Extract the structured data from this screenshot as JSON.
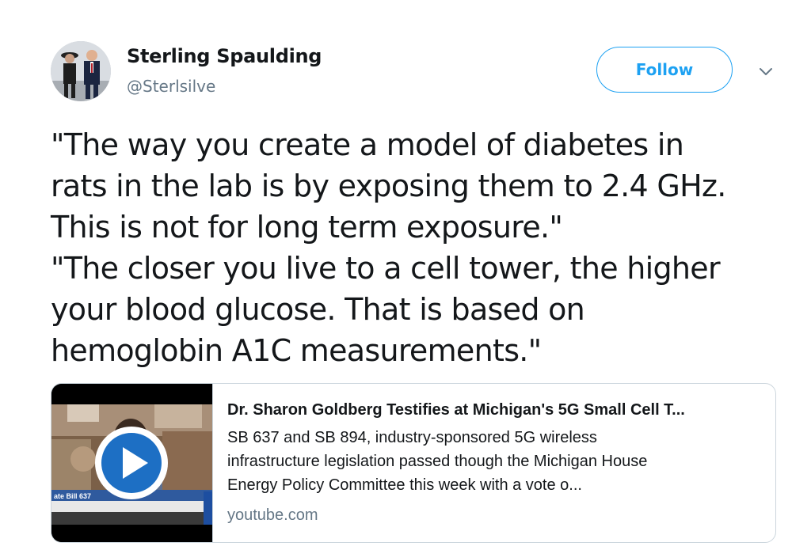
{
  "author": {
    "name": "Sterling Spaulding",
    "handle": "@Sterlsilve",
    "avatar_icon": "profile-photo"
  },
  "follow_button": {
    "label": "Follow",
    "color": "#1da1f2"
  },
  "menu_icon": "chevron-down-icon",
  "tweet": {
    "lines": [
      "\"The way you create a model of diabetes in",
      "rats in the lab is by exposing them to 2.4 GHz.",
      "This is not for long term exposure.\"",
      "\"The closer you live to a cell tower, the higher",
      "your blood glucose. That is based on",
      "hemoglobin A1C measurements.\""
    ]
  },
  "link_card": {
    "title": "Dr. Sharon Goldberg Testifies at Michigan's 5G Small Cell T...",
    "description_lines": [
      "SB 637 and SB 894, industry-sponsored 5G wireless",
      "infrastructure legislation passed though the Michigan House",
      "Energy Policy Committee this week with a vote o..."
    ],
    "domain": "youtube.com",
    "thumbnail": {
      "caption": "ate Bill 637",
      "play_icon": "play-icon",
      "play_color": "#1d6fc4"
    }
  },
  "colors": {
    "text": "#14171a",
    "secondary": "#657786",
    "border": "#ccd6dd",
    "accent": "#1da1f2"
  }
}
